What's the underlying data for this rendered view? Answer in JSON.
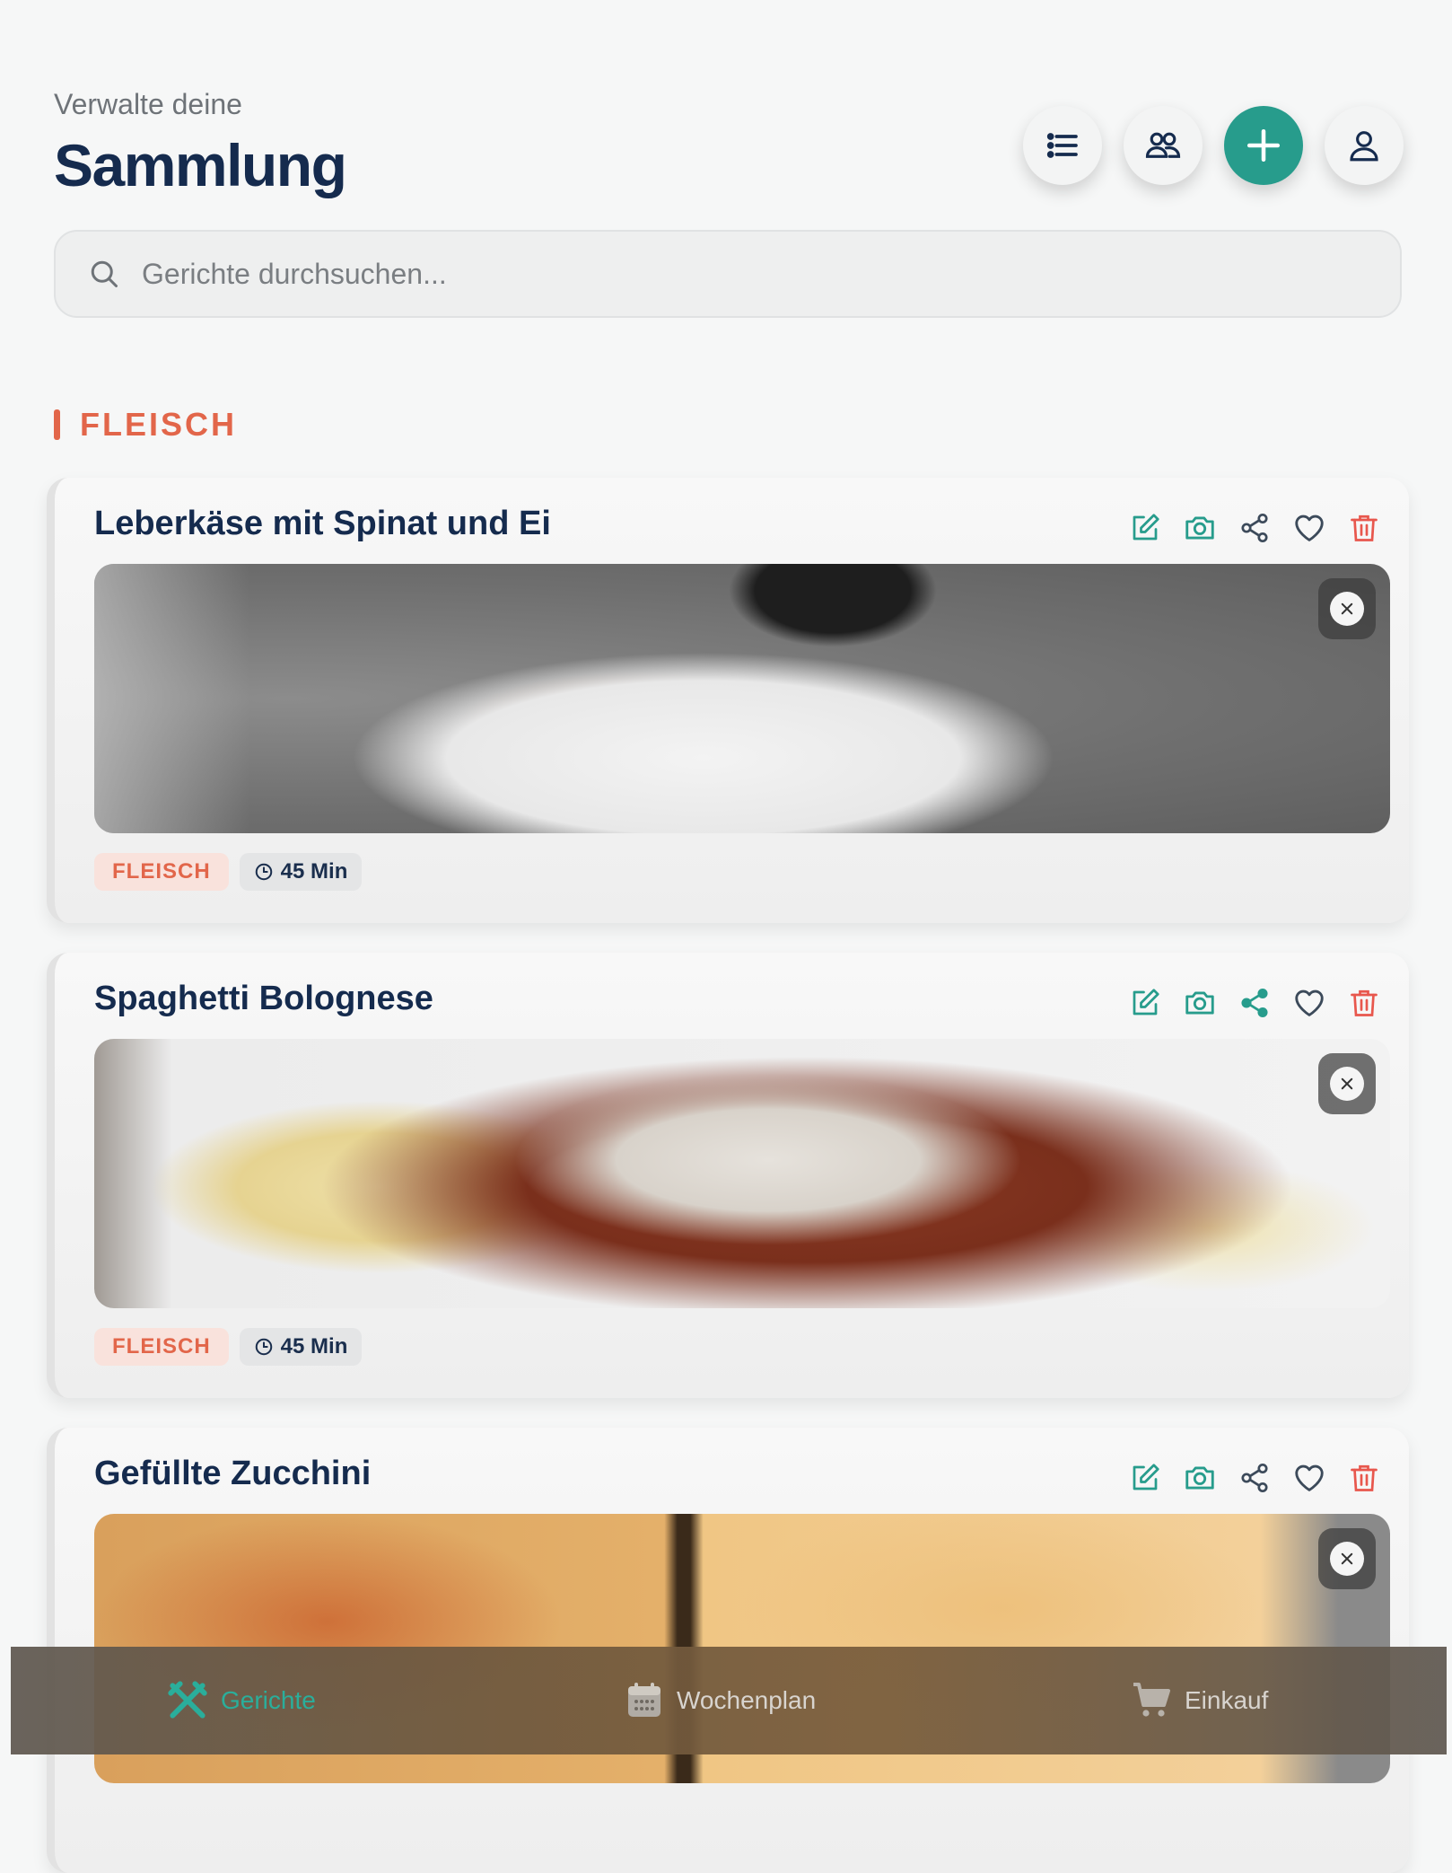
{
  "header": {
    "subtitle": "Verwalte deine",
    "title": "Sammlung"
  },
  "toolbar": [
    {
      "icon": "list-icon"
    },
    {
      "icon": "users-icon"
    },
    {
      "icon": "plus-icon",
      "color": "#279c8c"
    },
    {
      "icon": "user-icon"
    }
  ],
  "search": {
    "placeholder": "Gerichte durchsuchen...",
    "value": ""
  },
  "section": {
    "label": "FLEISCH",
    "color": "#e2664a"
  },
  "recipes": [
    {
      "title": "Leberkäse mit Spinat und Ei",
      "category": "FLEISCH",
      "time": "45 Min",
      "share_highlighted": false
    },
    {
      "title": "Spaghetti Bolognese",
      "category": "FLEISCH",
      "time": "45 Min",
      "share_highlighted": true
    },
    {
      "title": "Gefüllte Zucchini",
      "category": "",
      "time": "",
      "share_highlighted": false
    }
  ],
  "card_actions": [
    "edit-icon",
    "camera-icon",
    "share-icon",
    "heart-icon",
    "trash-icon"
  ],
  "bottom_nav": [
    {
      "label": "Gerichte",
      "icon": "cutlery-icon",
      "active": true
    },
    {
      "label": "Wochenplan",
      "icon": "calendar-icon",
      "active": false
    },
    {
      "label": "Einkauf",
      "icon": "cart-icon",
      "active": false
    }
  ],
  "colors": {
    "accent": "#279c8c",
    "meat": "#e2664a",
    "danger": "#e8574d",
    "text": "#152b4e"
  }
}
